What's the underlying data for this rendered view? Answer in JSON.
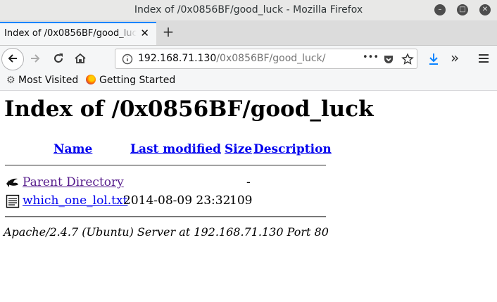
{
  "window": {
    "title": "Index of /0x0856BF/good_luck - Mozilla Firefox",
    "minimize_icon": "minimize-icon",
    "maximize_icon": "maximize-icon",
    "close_icon": "close-icon"
  },
  "tab": {
    "title": "Index of /0x0856BF/good_luck",
    "close": "✕",
    "new_tab": "+"
  },
  "navbar": {
    "url_host": "192.168.71.130",
    "url_path": "/0x0856BF/good_luck/",
    "more": "•••"
  },
  "bookmarks": {
    "most_visited": "Most Visited",
    "getting_started": "Getting Started"
  },
  "page": {
    "heading": "Index of /0x0856BF/good_luck",
    "columns": {
      "name": "Name",
      "last_modified": "Last modified",
      "size": "Size",
      "description": "Description"
    },
    "rows": [
      {
        "name": "Parent Directory",
        "modified": "",
        "size": "-",
        "icon": "back-arrow-icon"
      },
      {
        "name": "which_one_lol.txt",
        "modified": "2014-08-09 23:32",
        "size": "109",
        "icon": "text-file-icon"
      }
    ],
    "footer": "Apache/2.4.7 (Ubuntu) Server at 192.168.71.130 Port 80"
  },
  "colors": {
    "link": "#0000ee",
    "visited_link": "#551a8b",
    "accent": "#0a84ff"
  }
}
